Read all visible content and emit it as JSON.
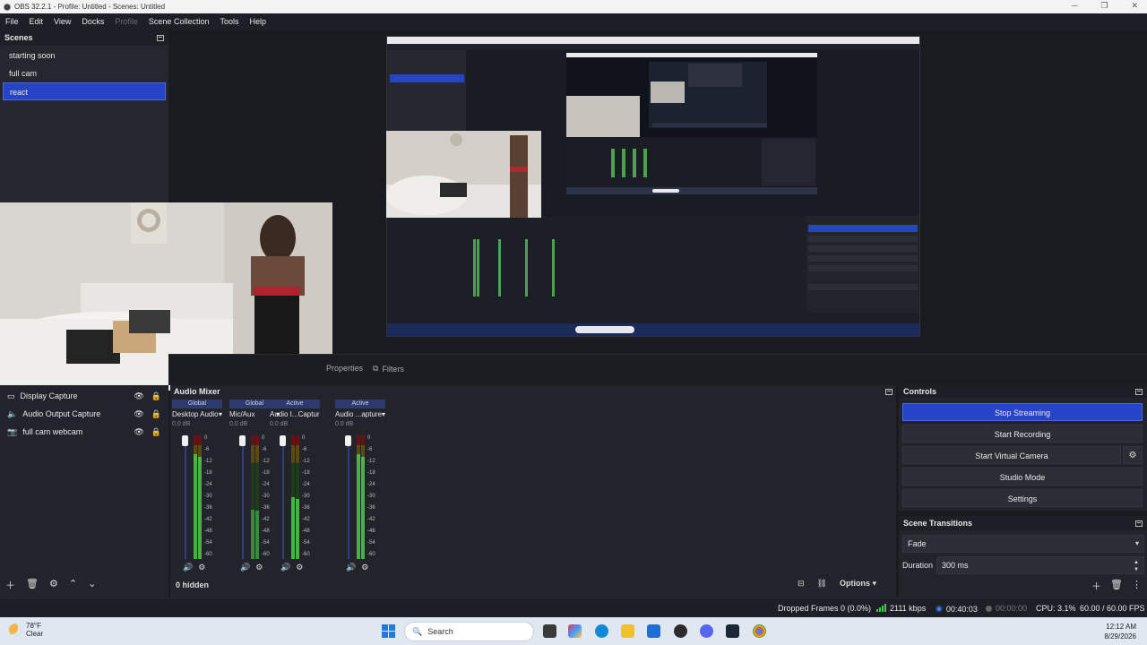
{
  "window": {
    "title": "OBS 32.2.1 - Profile: Untitled - Scenes: Untitled"
  },
  "menubar": {
    "items": [
      "File",
      "Edit",
      "View",
      "Docks",
      "Profile",
      "Scene Collection",
      "Tools",
      "Help"
    ]
  },
  "scenes": {
    "title": "Scenes",
    "items": [
      "starting soon",
      "full cam",
      "react"
    ],
    "active": "react"
  },
  "tabs": {
    "properties": "Properties",
    "filters": "Filters"
  },
  "sources": {
    "items": [
      {
        "label": "Display Capture",
        "icon": "monitor-icon"
      },
      {
        "label": "Audio Output Capture",
        "icon": "speaker-icon"
      },
      {
        "label": "full cam webcam",
        "icon": "camera-icon"
      }
    ]
  },
  "mixer": {
    "title": "Audio Mixer",
    "channels": [
      {
        "badge": "Global",
        "name": "Desktop Audio",
        "db": "0.0 dB",
        "level": 0.85
      },
      {
        "badge": "Global",
        "name": "Mic/Aux",
        "db": "0.0 dB",
        "level": 0.4
      },
      {
        "badge": "Active",
        "name": "Audio I...Capture",
        "db": "0.0 dB",
        "level": 0.5
      },
      {
        "badge": "Active",
        "name": "Audio ...apture",
        "db": "0.0 dB",
        "level": 0.85
      }
    ],
    "scale": [
      "0",
      "-6",
      "-12",
      "-18",
      "-24",
      "-30",
      "-36",
      "-42",
      "-48",
      "-54",
      "-60"
    ],
    "hidden": "0 hidden",
    "options": "Options"
  },
  "controls": {
    "title": "Controls",
    "buttons": [
      "Stop Streaming",
      "Start Recording",
      "Start Virtual Camera",
      "Studio Mode",
      "Settings"
    ]
  },
  "transitions": {
    "title": "Scene Transitions",
    "type": "Fade",
    "duration_label": "Duration",
    "duration_value": "300 ms"
  },
  "status": {
    "dropped": "Dropped Frames 0 (0.0%)",
    "bitrate": "2111 kbps",
    "stream_time": "00:40:03",
    "rec_time": "00:00:00",
    "cpu": "CPU: 3.1%",
    "fps": "60.00 / 60.00 FPS"
  },
  "taskbar": {
    "weather_temp": "78°F",
    "weather_cond": "Clear",
    "search_placeholder": "Search",
    "time": "12:12 AM",
    "date": "8/29/2026"
  },
  "colors": {
    "accent": "#2844c6",
    "panel": "#22232b",
    "background": "#1a1b20"
  }
}
